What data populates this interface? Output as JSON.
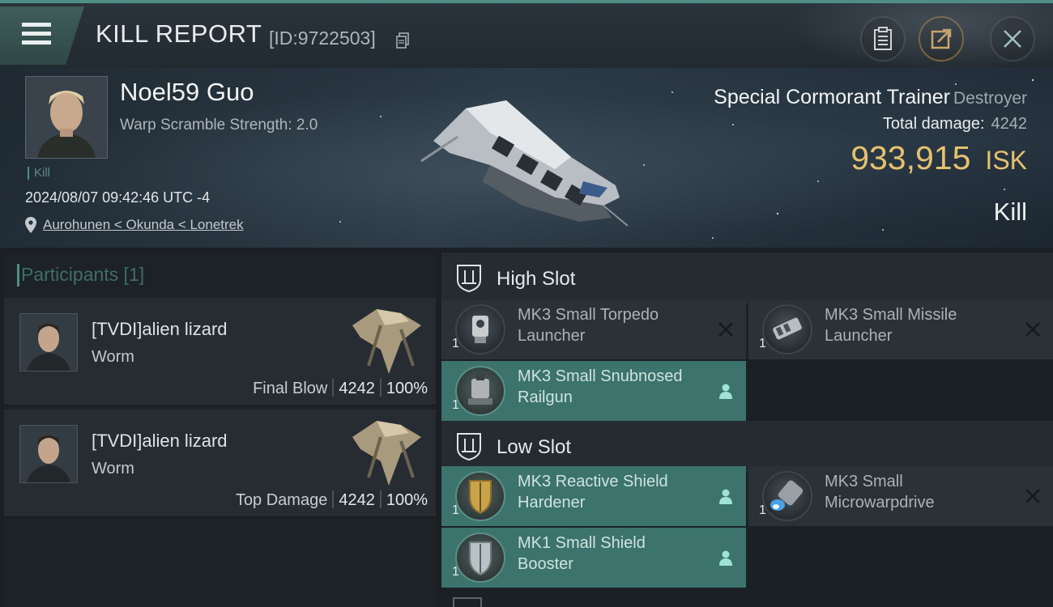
{
  "titlebar": {
    "title": "KILL REPORT",
    "kill_id": "[ID:9722503]",
    "buttons": [
      "clipboard-icon",
      "share-icon",
      "close-icon"
    ]
  },
  "victim": {
    "name": "Noel59 Guo",
    "warp_scramble": "Warp Scramble Strength: 2.0",
    "tag": "Kill",
    "timestamp": "2024/08/07 09:42:46 UTC -4",
    "location": "Aurohunen < Okunda < Lonetrek"
  },
  "ship": {
    "name": "Special Cormorant Trainer",
    "class": "Destroyer",
    "total_damage_label": "Total damage:",
    "total_damage": "4242",
    "isk_value": "933,915",
    "isk_unit": "ISK",
    "result": "Kill"
  },
  "participants": {
    "header": "Participants [1]",
    "items": [
      {
        "name": "[TVDI]alien lizard",
        "ship": "Worm",
        "role": "Final Blow",
        "damage": "4242",
        "percent": "100%"
      },
      {
        "name": "[TVDI]alien lizard",
        "ship": "Worm",
        "role": "Top Damage",
        "damage": "4242",
        "percent": "100%"
      }
    ]
  },
  "fitting": {
    "high_slot": {
      "label": "High Slot",
      "modules": [
        {
          "qty": "1",
          "name": "MK3 Small Torpedo Launcher",
          "status": "destroyed"
        },
        {
          "qty": "1",
          "name": "MK3 Small Missile Launcher",
          "status": "destroyed"
        },
        {
          "qty": "1",
          "name": "MK3 Small Snubnosed Railgun",
          "status": "dropped"
        }
      ]
    },
    "low_slot": {
      "label": "Low Slot",
      "modules": [
        {
          "qty": "1",
          "name": "MK3 Reactive Shield Hardener",
          "status": "dropped"
        },
        {
          "qty": "1",
          "name": "MK3 Small Microwarpdrive",
          "status": "destroyed"
        },
        {
          "qty": "1",
          "name": "MK1 Small Shield Booster",
          "status": "dropped"
        }
      ]
    }
  },
  "colors": {
    "accent": "#4d8f86",
    "isk": "#e6c16f",
    "dropped_bg": "#3c736c",
    "destroyed_bg": "#2a3137"
  }
}
